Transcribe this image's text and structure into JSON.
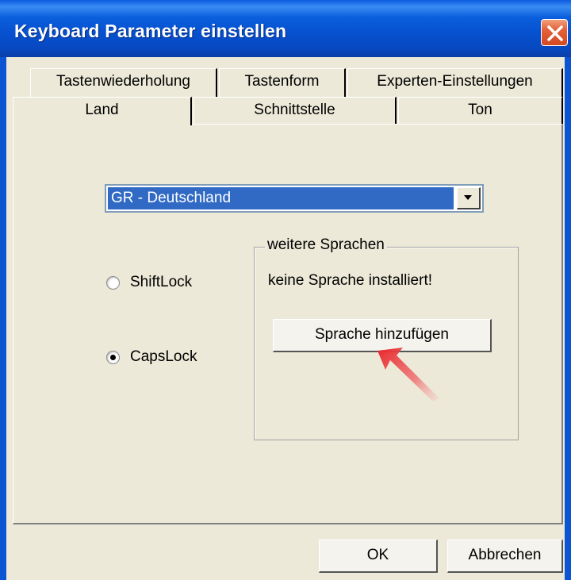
{
  "window": {
    "title": "Keyboard Parameter einstellen"
  },
  "tabs": {
    "row1": [
      {
        "label": "Tastenwiederholung"
      },
      {
        "label": "Tastenform"
      },
      {
        "label": "Experten-Einstellungen"
      }
    ],
    "row2": [
      {
        "label": "Land",
        "active": true
      },
      {
        "label": "Schnittstelle"
      },
      {
        "label": "Ton"
      }
    ]
  },
  "country": {
    "selected": "GR - Deutschland"
  },
  "lock_options": [
    {
      "label": "ShiftLock",
      "checked": false
    },
    {
      "label": "CapsLock",
      "checked": true
    }
  ],
  "more_languages": {
    "legend": "weitere Sprachen",
    "status": "keine Sprache installiert!",
    "add_button": "Sprache hinzufügen"
  },
  "footer": {
    "ok": "OK",
    "cancel": "Abbrechen"
  },
  "colors": {
    "accent": "#316AC5",
    "titlebar": "#0650CE",
    "pointer": "#E8262A"
  }
}
